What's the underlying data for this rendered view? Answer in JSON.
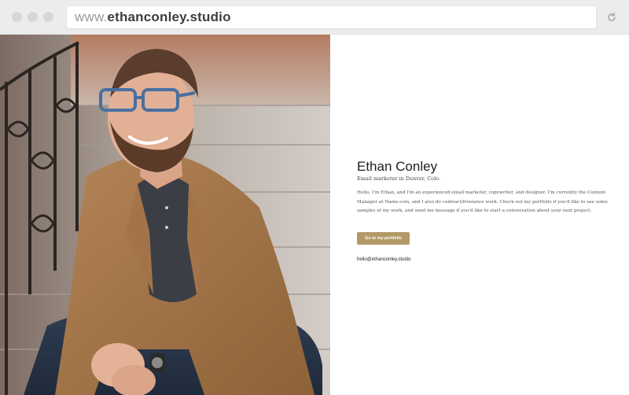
{
  "browser": {
    "url_prefix": "www.",
    "url_domain": "ethanconley.studio"
  },
  "profile": {
    "name": "Ethan Conley",
    "tagline": "Email marketer in Denver, Colo.",
    "bio": "Hello, I'm Ethan, and I'm an experienced email marketer, copywriter, and designer. I'm currently the Content Manager at Name.com, and I also do contract/freelance work. Check out my portfolio if you'd like to see some samples of my work, and send me message if you'd like to start a conversation about your next project.",
    "cta_label": "Go to my portfolio",
    "email": "hello@ethanconley.studio"
  },
  "colors": {
    "accent": "#b29a67",
    "chrome": "#ececec"
  }
}
